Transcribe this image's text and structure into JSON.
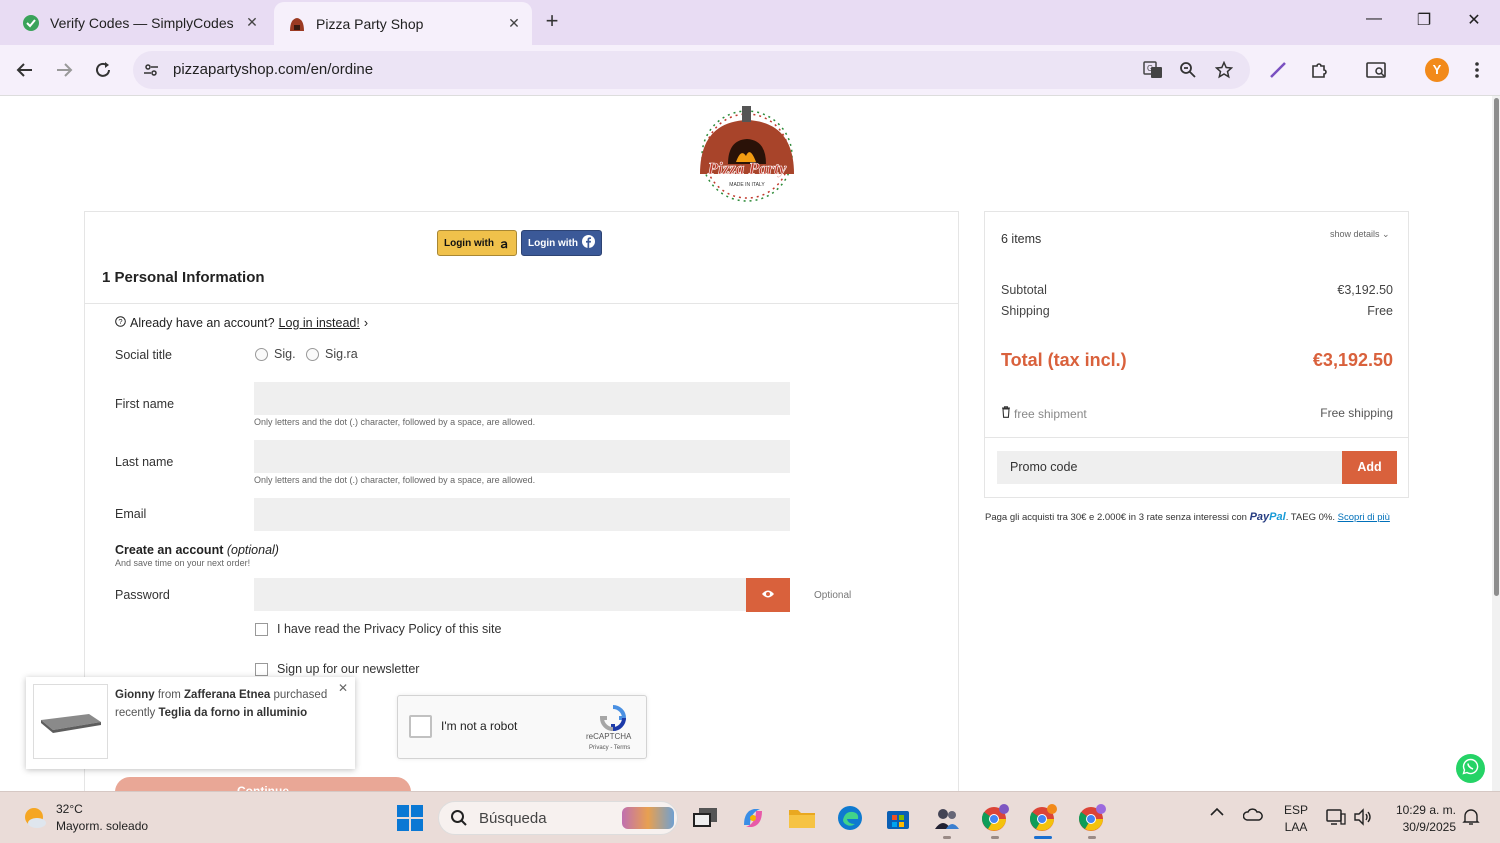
{
  "browser": {
    "tabs": [
      {
        "title": "Verify Codes — SimplyCodes",
        "active": false
      },
      {
        "title": "Pizza Party Shop",
        "active": true
      }
    ],
    "url": "pizzapartyshop.com/en/ordine",
    "profile_initial": "Y"
  },
  "checkout": {
    "login_amazon": "Login with",
    "login_facebook": "Login with",
    "step_title": "1 Personal Information",
    "already_account": "Already have an account?",
    "login_instead": "Log in instead!",
    "social_title_label": "Social title",
    "social_title_options": [
      "Sig.",
      "Sig.ra"
    ],
    "first_name_label": "First name",
    "last_name_label": "Last name",
    "name_hint": "Only letters and the dot (.) character, followed by a space, are allowed.",
    "email_label": "Email",
    "create_account_bold": "Create an account",
    "create_account_italic": "(optional)",
    "create_account_sub": "And save time on your next order!",
    "password_label": "Password",
    "password_optional": "Optional",
    "privacy_check": "I have read the Privacy Policy of this site",
    "newsletter_check": "Sign up for our newsletter",
    "continue_label": "Continue"
  },
  "recaptcha": {
    "label": "I'm not a robot",
    "brand": "reCAPTCHA",
    "terms": "Privacy - Terms"
  },
  "popup": {
    "name": "Gionny",
    "from_word": "from",
    "city": "Zafferana Etnea",
    "purchased_word": "purchased",
    "recently_word": "recently",
    "product": "Teglia da forno in alluminio"
  },
  "summary": {
    "items": "6 items",
    "show_details": "show details",
    "subtotal_label": "Subtotal",
    "subtotal_value": "€3,192.50",
    "shipping_label": "Shipping",
    "shipping_value": "Free",
    "total_label": "Total (tax incl.)",
    "total_value": "€3,192.50",
    "free_shipment_label": "free shipment",
    "free_shipping_value": "Free shipping",
    "promo_placeholder": "Promo code",
    "promo_add": "Add"
  },
  "paypal": {
    "text": "Paga gli acquisti tra 30€ e 2.000€ in 3 rate senza interessi con",
    "brand_a": "Pay",
    "brand_b": "Pal",
    "taeg": ". TAEG 0%.",
    "link": "Scopri di più"
  },
  "taskbar": {
    "temp": "32°C",
    "weather": "Mayorm. soleado",
    "search_label": "Búsqueda",
    "lang_top": "ESP",
    "lang_bottom": "LAA",
    "time": "10:29 a. m.",
    "date": "30/9/2025"
  },
  "colors": {
    "accent": "#d9613c",
    "amazon": "#f0c14b",
    "facebook": "#3b5998",
    "tabbar": "#e8dcf3",
    "taskbar": "#eadcd8"
  }
}
